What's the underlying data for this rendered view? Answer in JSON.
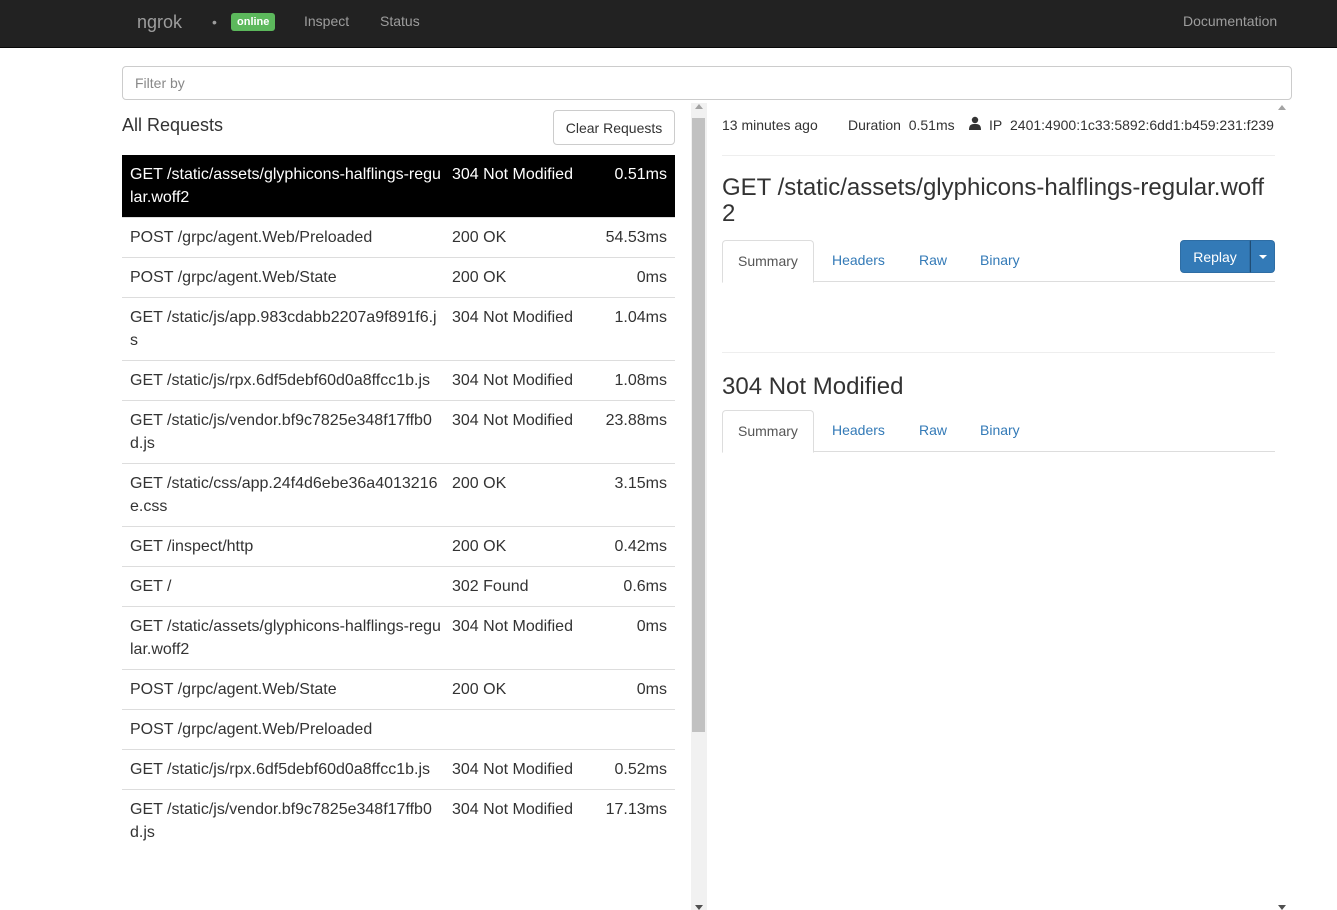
{
  "navbar": {
    "brand": "ngrok",
    "dot": "•",
    "status_badge": "online",
    "links": {
      "inspect": "Inspect",
      "status": "Status",
      "documentation": "Documentation"
    }
  },
  "filter": {
    "placeholder": "Filter by",
    "value": ""
  },
  "requests": {
    "title": "All Requests",
    "clear_label": "Clear Requests",
    "rows": [
      {
        "path": "GET /static/assets/glyphicons-halflings-regular.woff2",
        "status": "304 Not Modified",
        "duration": "0.51ms"
      },
      {
        "path": "POST /grpc/agent.Web/Preloaded",
        "status": "200 OK",
        "duration": "54.53ms"
      },
      {
        "path": "POST /grpc/agent.Web/State",
        "status": "200 OK",
        "duration": "0ms"
      },
      {
        "path": "GET /static/js/app.983cdabb2207a9f891f6.js",
        "status": "304 Not Modified",
        "duration": "1.04ms"
      },
      {
        "path": "GET /static/js/rpx.6df5debf60d0a8ffcc1b.js",
        "status": "304 Not Modified",
        "duration": "1.08ms"
      },
      {
        "path": "GET /static/js/vendor.bf9c7825e348f17ffb0d.js",
        "status": "304 Not Modified",
        "duration": "23.88ms"
      },
      {
        "path": "GET /static/css/app.24f4d6ebe36a4013216e.css",
        "status": "200 OK",
        "duration": "3.15ms"
      },
      {
        "path": "GET /inspect/http",
        "status": "200 OK",
        "duration": "0.42ms"
      },
      {
        "path": "GET /",
        "status": "302 Found",
        "duration": "0.6ms"
      },
      {
        "path": "GET /static/assets/glyphicons-halflings-regular.woff2",
        "status": "304 Not Modified",
        "duration": "0ms"
      },
      {
        "path": "POST /grpc/agent.Web/State",
        "status": "200 OK",
        "duration": "0ms"
      },
      {
        "path": "POST /grpc/agent.Web/Preloaded",
        "status": "",
        "duration": ""
      },
      {
        "path": "GET /static/js/rpx.6df5debf60d0a8ffcc1b.js",
        "status": "304 Not Modified",
        "duration": "0.52ms"
      },
      {
        "path": "GET /static/js/vendor.bf9c7825e348f17ffb0d.js",
        "status": "304 Not Modified",
        "duration": "17.13ms"
      }
    ]
  },
  "detail": {
    "time_ago": "13 minutes ago",
    "duration_label": "Duration",
    "duration_value": "0.51ms",
    "ip_label": "IP",
    "ip_value": "2401:4900:1c33:5892:6dd1:b459:231:f239",
    "request_title": "GET /static/assets/glyphicons-halflings-regular.woff2",
    "response_title": "304 Not Modified",
    "tabs": {
      "summary": "Summary",
      "headers": "Headers",
      "raw": "Raw",
      "binary": "Binary"
    },
    "replay_label": "Replay"
  },
  "colors": {
    "navbar": "#222222",
    "online_badge": "#5cb85c",
    "link": "#337ab7",
    "primary": "#337ab7"
  }
}
